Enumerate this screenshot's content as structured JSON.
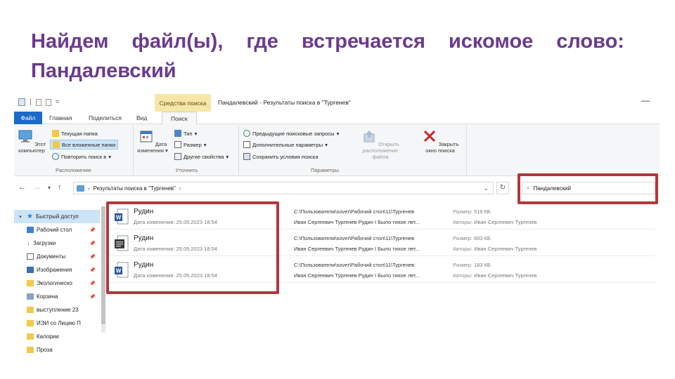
{
  "slide": {
    "title_words": [
      "Найдем",
      "файл(ы),",
      "где",
      "встречается",
      "искомое",
      "слово:"
    ],
    "title_line2": "Пандалевский"
  },
  "window": {
    "context_tab": "Средства поиска",
    "title": "Пандалевский - Результаты поиска в \"Тургенев\""
  },
  "tabs": {
    "file": "Файл",
    "home": "Главная",
    "share": "Поделиться",
    "view": "Вид",
    "search": "Поиск"
  },
  "ribbon": {
    "location": {
      "label": "Расположение",
      "this_pc": "Этот компьютер",
      "current_folder": "Текущая папка",
      "all_subfolders": "Все вложенные папки",
      "search_again": "Повторить поиск в"
    },
    "refine": {
      "label": "Уточнить",
      "date_modified": "Дата изменения",
      "kind": "Тип",
      "size": "Размер",
      "other_props": "Другие свойства"
    },
    "options": {
      "label": "Параметры",
      "recent_searches": "Предыдущие поисковые запросы",
      "advanced": "Дополнительные параметры",
      "save_search": "Сохранить условия поиска",
      "open_location": "Открыть расположение файла",
      "close_search": "Закрыть окно поиска"
    }
  },
  "address": {
    "path": "Результаты поиска в \"Тургенев\"",
    "search_value": "Пандалевский"
  },
  "nav": {
    "items": [
      {
        "label": "Быстрый доступ",
        "pinned": false
      },
      {
        "label": "Рабочий стол",
        "pinned": true
      },
      {
        "label": "Загрузки",
        "pinned": true
      },
      {
        "label": "Документы",
        "pinned": true
      },
      {
        "label": "Изображения",
        "pinned": true
      },
      {
        "label": "Экологическо",
        "pinned": true
      },
      {
        "label": "Корзина",
        "pinned": true
      },
      {
        "label": "выступление 23",
        "pinned": false
      },
      {
        "label": "ИЭИ со Лицею П",
        "pinned": false
      },
      {
        "label": "Калории",
        "pinned": false
      },
      {
        "label": "Проза",
        "pinned": false
      }
    ]
  },
  "results": {
    "date_prefix": "Дата изменения:",
    "size_prefix": "Размер:",
    "author_prefix": "Авторы:",
    "rows": [
      {
        "name": "Рудин",
        "date": "25.05.2023 18:54",
        "path": "C:\\Пользователи\\sover\\Рабочий стол\\11\\Тургенев",
        "doc_title": "Иван Сергеевич Тургенев Рудин I Было тихое лет...",
        "size": "519 КБ",
        "author": "Иван Сергеевич Тургенев"
      },
      {
        "name": "Рудин",
        "date": "25.05.2023 18:54",
        "path": "C:\\Пользователи\\sover\\Рабочий стол\\11\\Тургенев",
        "doc_title": "Иван Сергеевич Тургенев Рудин I Было тихое лет...",
        "size": "603 КБ",
        "author": "Иван Сергеевич Тургенев"
      },
      {
        "name": "Рудин",
        "date": "25.05.2023 18:54",
        "path": "C:\\Пользователи\\sover\\Рабочий стол\\11\\Тургенев",
        "doc_title": "Иван Сергеевич Тургенев Рудин I Было тихое лет...",
        "size": "183 КБ",
        "author": "Иван Сергеевич Тургенев"
      }
    ]
  },
  "colors": {
    "title": "#6b3a8e",
    "highlight": "#b3373a",
    "file_tab": "#1b6ac9",
    "context_tab": "#f6e7a7"
  }
}
